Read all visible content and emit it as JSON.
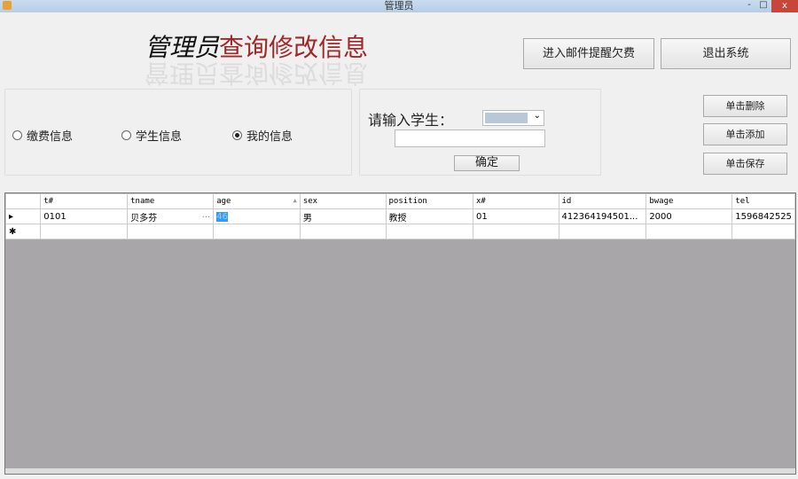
{
  "window": {
    "title": "管理员",
    "min": "-",
    "max": "□",
    "close": "x"
  },
  "heading": {
    "part1": "管理员",
    "part2": "查询修改信息"
  },
  "buttons": {
    "email": "进入邮件提醒欠费",
    "exit": "退出系统",
    "delete": "单击删除",
    "add": "单击添加",
    "save": "单击保存",
    "confirm": "确定"
  },
  "radios": [
    {
      "label": "缴费信息",
      "checked": false
    },
    {
      "label": "学生信息",
      "checked": false
    },
    {
      "label": "我的信息",
      "checked": true
    }
  ],
  "search": {
    "label": "请输入学生：",
    "input_value": ""
  },
  "table": {
    "columns": [
      "t#",
      "tname",
      "age",
      "sex",
      "position",
      "x#",
      "id",
      "bwage",
      "tel"
    ],
    "sort_indicator": "▲",
    "rows": [
      [
        "0101",
        "贝多芬",
        "46",
        "男",
        "教授",
        "01",
        "412364194501...",
        "2000",
        "1596842525"
      ]
    ],
    "row_marker": "▸",
    "new_row_marker": "✱",
    "ellipsis": "..."
  }
}
